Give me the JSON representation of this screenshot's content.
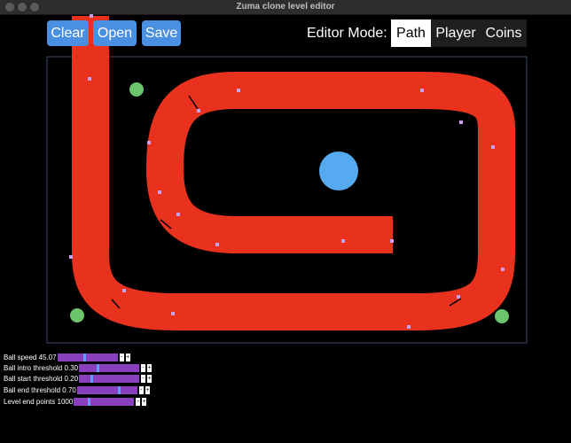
{
  "window": {
    "title": "Zuma clone level editor"
  },
  "toolbar": {
    "clear_label": "Clear",
    "open_label": "Open",
    "save_label": "Save"
  },
  "mode": {
    "label": "Editor Mode:",
    "options": [
      "Path",
      "Player",
      "Coins"
    ],
    "selected": "Path"
  },
  "colors": {
    "path": "#e8321e",
    "player": "#55aaf0",
    "coin": "#6cc46c",
    "control_point": "#c8a0f0",
    "button": "#4a90e2",
    "slider": "#8a3fbf",
    "slider_handle": "#5aa0ff"
  },
  "settings": [
    {
      "label": "Ball speed",
      "value": "45.07",
      "position": 0.45
    },
    {
      "label": "Ball intro threshold",
      "value": "0.30",
      "position": 0.3
    },
    {
      "label": "Ball start threshold",
      "value": "0.20",
      "position": 0.2
    },
    {
      "label": "Ball end threshold",
      "value": "0.70",
      "position": 0.7
    },
    {
      "label": "Level end points",
      "value": "1000",
      "position": 0.25
    }
  ]
}
